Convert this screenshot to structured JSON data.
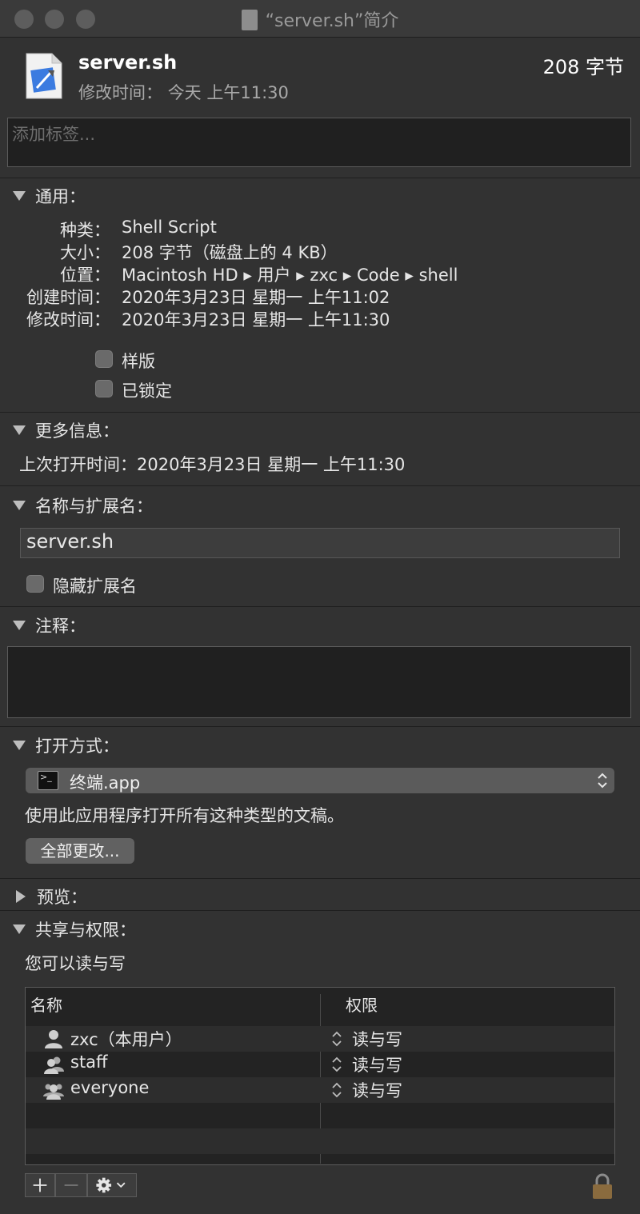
{
  "window": {
    "title": "“server.sh”简介"
  },
  "header": {
    "file_name": "server.sh",
    "modified_label": "修改时间：",
    "modified_value": "今天 上午11:30",
    "size": "208 字节"
  },
  "tags": {
    "placeholder": "添加标签..."
  },
  "general": {
    "title": "通用：",
    "rows": [
      {
        "label": "种类：",
        "value": "Shell Script"
      },
      {
        "label": "大小：",
        "value": "208 字节（磁盘上的 4 KB）"
      },
      {
        "label": "位置：",
        "value": "Macintosh HD ▸ 用户 ▸ zxc ▸ Code ▸ shell"
      },
      {
        "label": "创建时间：",
        "value": "2020年3月23日 星期一 上午11:02"
      },
      {
        "label": "修改时间：",
        "value": "2020年3月23日 星期一 上午11:30"
      }
    ],
    "stationery_label": "样版",
    "locked_label": "已锁定"
  },
  "more_info": {
    "title": "更多信息：",
    "last_opened_label": "上次打开时间：",
    "last_opened_value": "2020年3月23日 星期一 上午11:30"
  },
  "name_ext": {
    "title": "名称与扩展名：",
    "name_value": "server.sh",
    "hide_ext_label": "隐藏扩展名"
  },
  "comments": {
    "title": "注释："
  },
  "open_with": {
    "title": "打开方式：",
    "app": "终端.app",
    "description": "使用此应用程序打开所有这种类型的文稿。",
    "change_all": "全部更改..."
  },
  "preview": {
    "title": "预览："
  },
  "sharing": {
    "title": "共享与权限：",
    "summary": "您可以读与写",
    "columns": [
      "名称",
      "权限"
    ],
    "rows": [
      {
        "name": "zxc（本用户）",
        "permission": "读与写",
        "icon": "user-icon"
      },
      {
        "name": "staff",
        "permission": "读与写",
        "icon": "group-icon"
      },
      {
        "name": "everyone",
        "permission": "读与写",
        "icon": "group-icon"
      }
    ]
  },
  "icons": {
    "add": "plus-icon",
    "remove": "minus-icon",
    "action": "gear-icon",
    "lock": "lock-icon"
  }
}
